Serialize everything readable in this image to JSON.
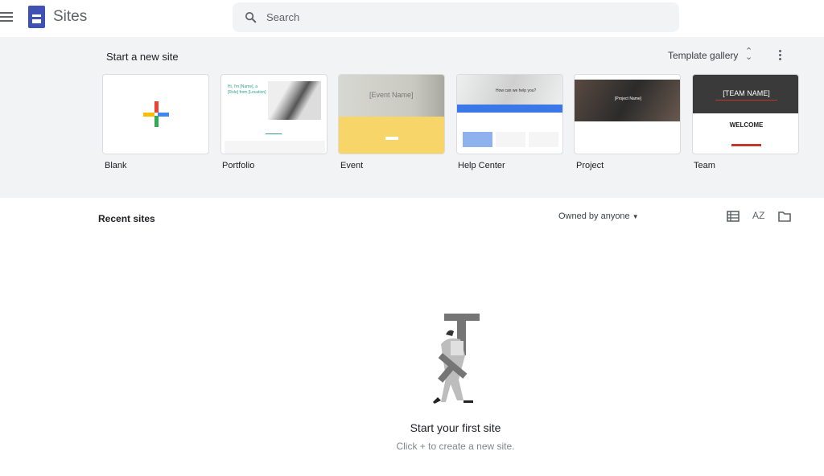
{
  "header": {
    "app_title": "Sites",
    "search_placeholder": "Search"
  },
  "templates": {
    "title": "Start a new site",
    "gallery_label": "Template gallery",
    "items": [
      {
        "label": "Blank"
      },
      {
        "label": "Portfolio",
        "thumb_text": "Hi, I'm [Name], a [Role] from [Location]"
      },
      {
        "label": "Event",
        "thumb_text": "[Event Name]"
      },
      {
        "label": "Help Center",
        "thumb_text": "How can we help you?"
      },
      {
        "label": "Project",
        "thumb_text": "[Project Name]"
      },
      {
        "label": "Team",
        "thumb_text": "[TEAM NAME]",
        "thumb_sub": "WELCOME"
      }
    ]
  },
  "recent": {
    "title": "Recent sites",
    "owner_filter": "Owned by anyone",
    "empty_title": "Start your first site",
    "empty_subtitle": "Click + to create a new site."
  },
  "colors": {
    "brand": "#3f51b5",
    "band": "#f1f3f4",
    "help_blue": "#3b78e7",
    "event_yellow": "#f8d568",
    "team_red": "#c0392b"
  }
}
